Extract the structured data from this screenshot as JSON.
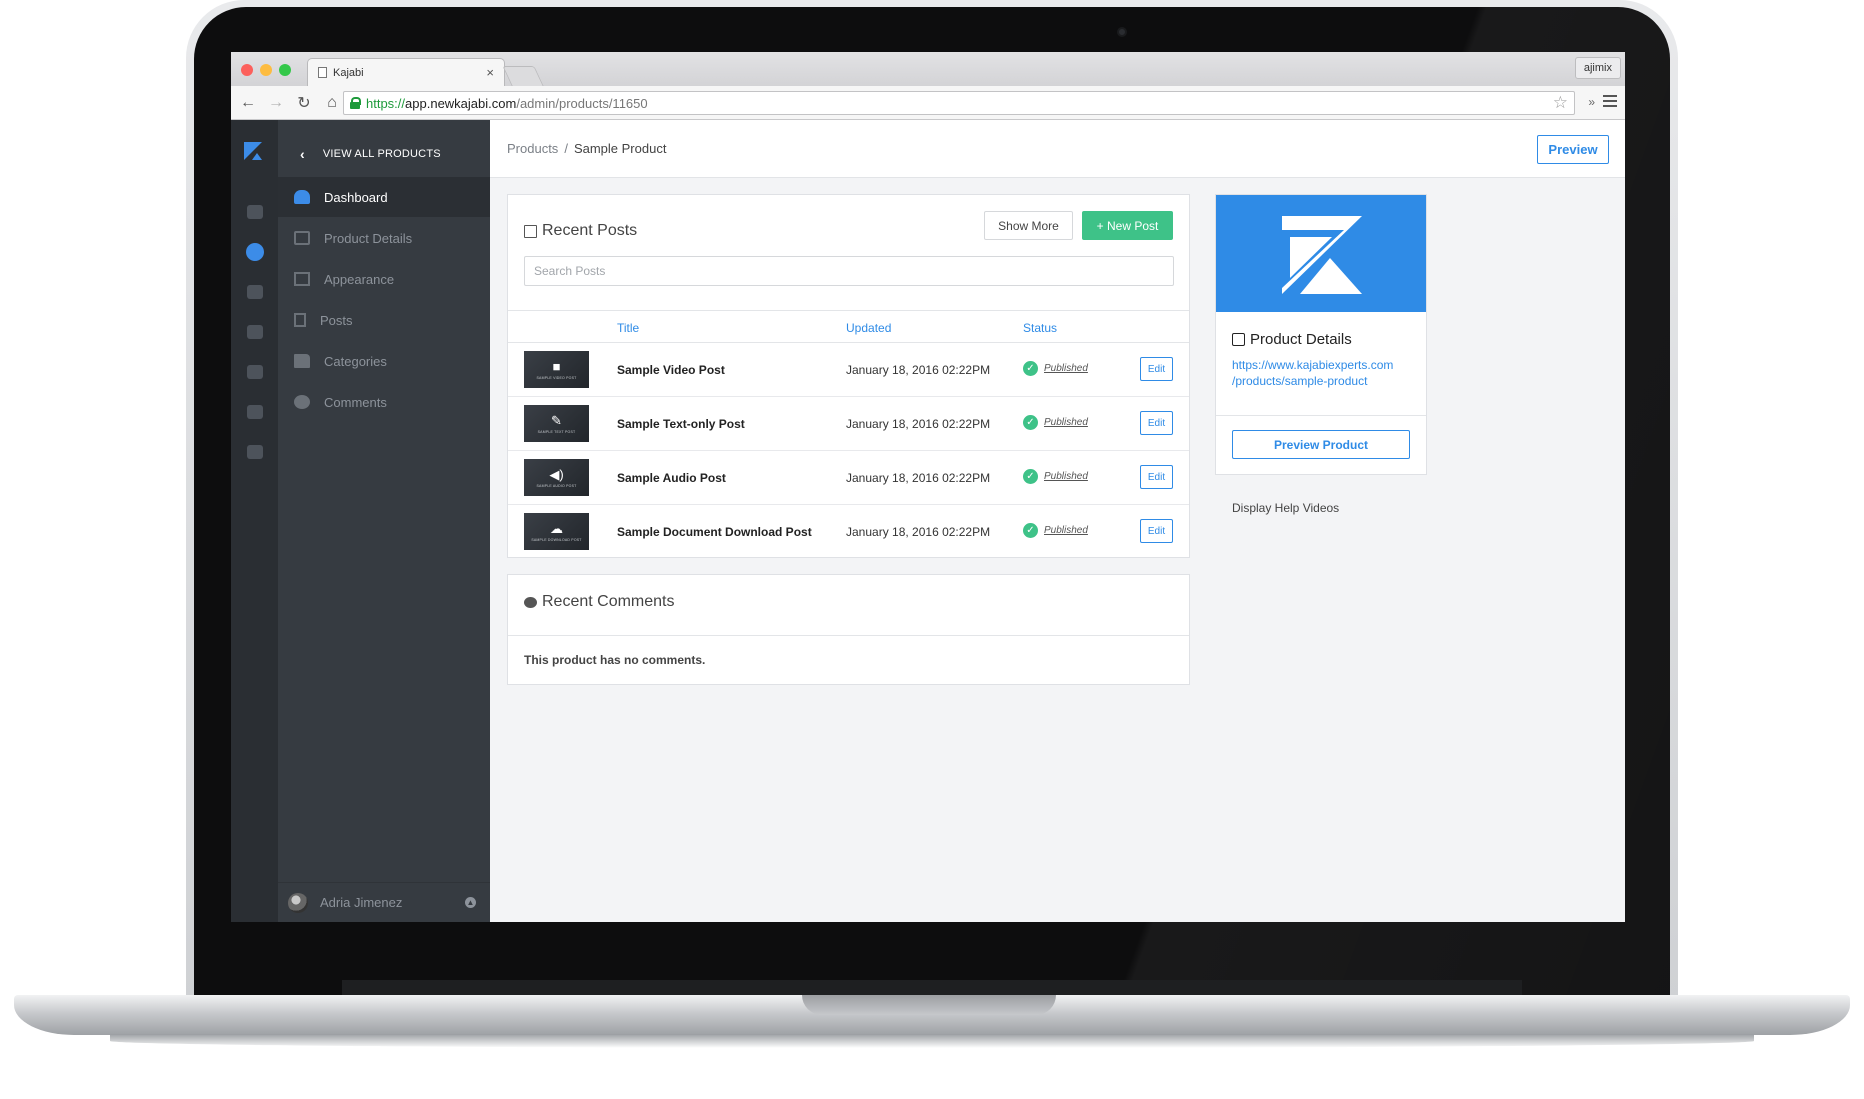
{
  "browser": {
    "tab_title": "Kajabi",
    "tab_close": "×",
    "profile": "ajimix",
    "url_scheme": "https://",
    "url_host": "app.newkajabi.com",
    "url_path": "/admin/products/11650",
    "more_extensions": "»"
  },
  "sidebar": {
    "back_label": "VIEW ALL PRODUCTS",
    "back_chevron": "‹",
    "items": [
      {
        "label": "Dashboard",
        "icon": "dashboard-icon",
        "active": true
      },
      {
        "label": "Product Details",
        "icon": "edit-icon",
        "active": false
      },
      {
        "label": "Appearance",
        "icon": "image-icon",
        "active": false
      },
      {
        "label": "Posts",
        "icon": "copy-icon",
        "active": false
      },
      {
        "label": "Categories",
        "icon": "folder-icon",
        "active": false
      },
      {
        "label": "Comments",
        "icon": "comments-icon",
        "active": false
      }
    ],
    "user_name": "Adria Jimenez"
  },
  "icon_rail": {
    "items": [
      "dashboard-icon",
      "products-icon",
      "cart-icon",
      "user-icon",
      "monitor-icon",
      "copy-icon",
      "gear-icon"
    ],
    "active_index": 1
  },
  "header": {
    "breadcrumb_root": "Products",
    "breadcrumb_sep": "/",
    "breadcrumb_current": "Sample Product",
    "preview_label": "Preview"
  },
  "posts": {
    "title": "Recent Posts",
    "show_more_label": "Show More",
    "new_post_label": "+ New Post",
    "search_placeholder": "Search Posts",
    "columns": {
      "title": "Title",
      "updated": "Updated",
      "status": "Status"
    },
    "rows": [
      {
        "thumb_icon": "video-icon",
        "thumb_glyph": "■",
        "thumb_caption": "SAMPLE VIDEO POST",
        "title": "Sample Video Post",
        "updated": "January 18, 2016 02:22PM",
        "status": "Published",
        "edit": "Edit"
      },
      {
        "thumb_icon": "pencil-icon",
        "thumb_glyph": "✎",
        "thumb_caption": "SAMPLE TEXT POST",
        "title": "Sample Text-only Post",
        "updated": "January 18, 2016 02:22PM",
        "status": "Published",
        "edit": "Edit"
      },
      {
        "thumb_icon": "speaker-icon",
        "thumb_glyph": "◀)",
        "thumb_caption": "SAMPLE AUDIO POST",
        "title": "Sample Audio Post",
        "updated": "January 18, 2016 02:22PM",
        "status": "Published",
        "edit": "Edit"
      },
      {
        "thumb_icon": "cloud-download-icon",
        "thumb_glyph": "☁",
        "thumb_caption": "SAMPLE DOWNLOAD POST",
        "title": "Sample Document Download Post",
        "updated": "January 18, 2016 02:22PM",
        "status": "Published",
        "edit": "Edit"
      }
    ]
  },
  "comments": {
    "title": "Recent Comments",
    "empty_text": "This product has no comments."
  },
  "product_card": {
    "title": "Product Details",
    "link_line1": "https://www.kajabiexperts.com",
    "link_line2": "/products/sample-product",
    "preview_product_label": "Preview Product",
    "hero_color": "#2f8be6"
  },
  "help": {
    "label": "Display Help Videos"
  },
  "colors": {
    "accent": "#2f8be6",
    "success": "#3ec288",
    "sidebar_dark": "#363b41",
    "rail_dark": "#2a2e33"
  }
}
